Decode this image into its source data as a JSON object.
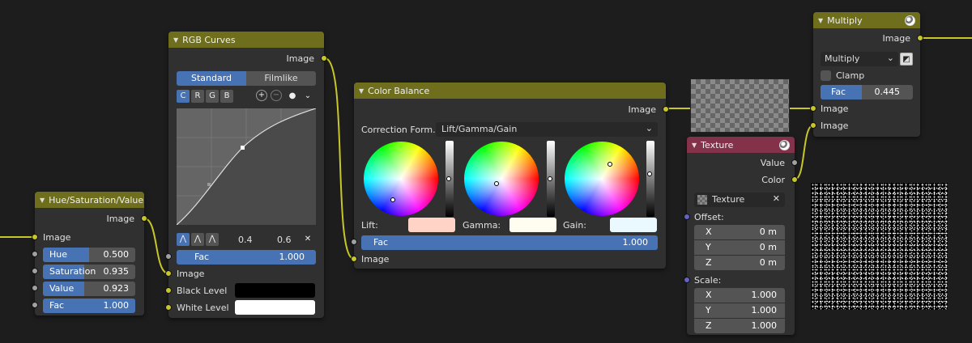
{
  "hsv": {
    "title": "Hue/Saturation/Value",
    "out_image": "Image",
    "in_image": "Image",
    "fields": [
      {
        "label": "Hue",
        "value": "0.500",
        "fraction": 0.5
      },
      {
        "label": "Saturation",
        "value": "0.935",
        "fraction": 0.935
      },
      {
        "label": "Value",
        "value": "0.923",
        "fraction": 0.923
      },
      {
        "label": "Fac",
        "value": "1.000",
        "fraction": 1.0
      }
    ]
  },
  "rgb_curves": {
    "title": "RGB Curves",
    "out_image": "Image",
    "tabs": [
      "Standard",
      "Filmlike"
    ],
    "channels": [
      "C",
      "R",
      "G",
      "B"
    ],
    "point_x": "0.4",
    "point_y": "0.6",
    "fac_label": "Fac",
    "fac_value": "1.000",
    "in_image": "Image",
    "black_level": "Black Level",
    "white_level": "White Level",
    "black_color": "#000000",
    "white_color": "#ffffff"
  },
  "color_balance": {
    "title": "Color Balance",
    "out_image": "Image",
    "correction_label": "Correction Form...",
    "correction_value": "Lift/Gamma/Gain",
    "lift_label": "Lift:",
    "gamma_label": "Gamma:",
    "gain_label": "Gain:",
    "lift_color": "#ffd4c6",
    "gamma_color": "#fffdf0",
    "gain_color": "#eaf8ff",
    "fac_label": "Fac",
    "fac_value": "1.000",
    "in_image": "Image"
  },
  "multiply": {
    "title": "Multiply",
    "out_image": "Image",
    "blend_mode": "Multiply",
    "clamp_label": "Clamp",
    "fac_label": "Fac",
    "fac_value": "0.445",
    "fac_fraction": 0.445,
    "in_image_1": "Image",
    "in_image_2": "Image"
  },
  "texture": {
    "title": "Texture",
    "out_value": "Value",
    "out_color": "Color",
    "texture_name": "Texture",
    "offset_label": "Offset:",
    "offset": [
      {
        "axis": "X",
        "value": "0 m"
      },
      {
        "axis": "Y",
        "value": "0 m"
      },
      {
        "axis": "Z",
        "value": "0 m"
      }
    ],
    "scale_label": "Scale:",
    "scale": [
      {
        "axis": "X",
        "value": "1.000"
      },
      {
        "axis": "Y",
        "value": "1.000"
      },
      {
        "axis": "Z",
        "value": "1.000"
      }
    ]
  },
  "colors": {
    "color_header": "#6e6e1d",
    "texture_header": "#83324a",
    "accent": "#4772b3",
    "socket_color": "#c7c729",
    "socket_gray": "#a1a1a1",
    "socket_vector": "#6363c7"
  }
}
